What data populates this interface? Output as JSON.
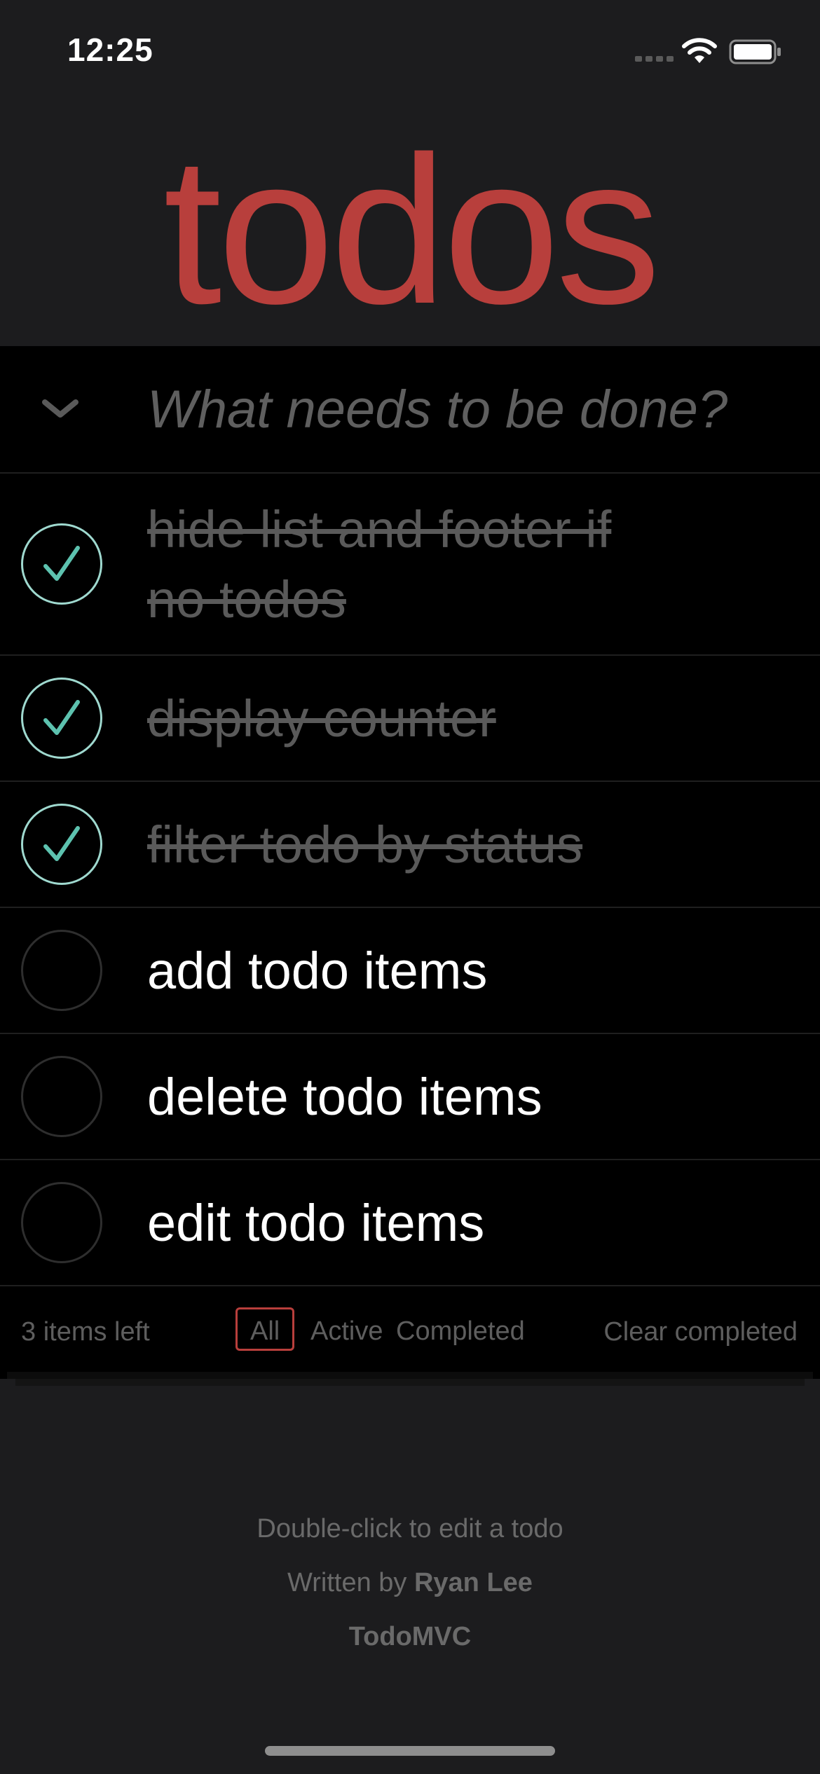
{
  "status_bar": {
    "time": "12:25"
  },
  "app": {
    "title": "todos"
  },
  "new_todo": {
    "placeholder": "What needs to be done?",
    "value": ""
  },
  "todos": [
    {
      "title": "hide list and footer if no todos",
      "completed": true
    },
    {
      "title": "display counter",
      "completed": true
    },
    {
      "title": "filter todo by status",
      "completed": true
    },
    {
      "title": "add todo items",
      "completed": false
    },
    {
      "title": "delete todo items",
      "completed": false
    },
    {
      "title": "edit todo items",
      "completed": false
    }
  ],
  "footer": {
    "items_left": "3 items left",
    "filters": [
      "All",
      "Active",
      "Completed"
    ],
    "selected_filter": "All",
    "clear_completed": "Clear completed"
  },
  "info": {
    "hint": "Double-click to edit a todo",
    "written_by_prefix": "Written by",
    "author": "Ryan Lee",
    "project": "TodoMVC"
  },
  "colors": {
    "accent": "#b83f3c",
    "check": "#5dc2af",
    "background": "#1c1c1e",
    "card": "#000000"
  },
  "icons": {
    "toggle_all": "chevron-down-icon",
    "completed_check": "check-icon",
    "wifi": "wifi-icon",
    "battery": "battery-icon",
    "cellular": "cellular-icon"
  }
}
